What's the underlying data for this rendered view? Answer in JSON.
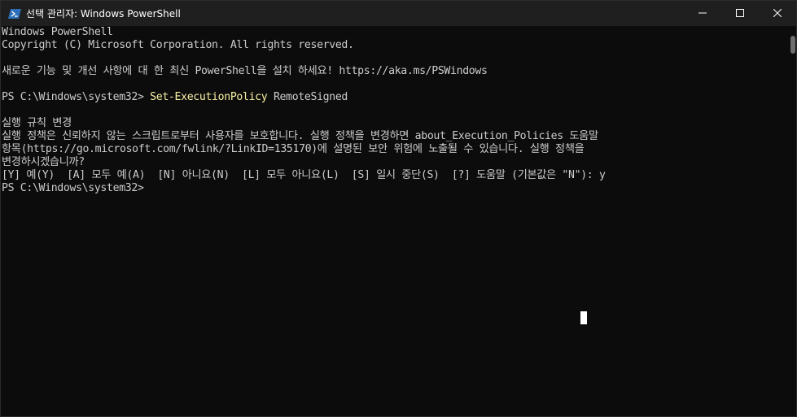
{
  "window": {
    "title": "선택 관리자: Windows PowerShell",
    "icon": "powershell-icon",
    "controls": [
      "minimize-icon",
      "maximize-icon",
      "close-icon"
    ]
  },
  "console": {
    "lines": [
      "Windows PowerShell",
      "Copyright (C) Microsoft Corporation. All rights reserved.",
      "",
      "새로운 기능 및 개선 사항에 대 한 최신 PowerShell을 설치 하세요! https://aka.ms/PSWindows",
      "",
      "",
      "",
      "실행 규칙 변경",
      "실행 정책은 신뢰하지 않는 스크립트로부터 사용자를 보호합니다. 실행 정책을 변경하면 about_Execution_Policies 도움말",
      "항목(https://go.microsoft.com/fwlink/?LinkID=135170)에 설명된 보안 위험에 노출될 수 있습니다. 실행 정책을",
      "변경하시겠습니까?",
      "[Y] 예(Y)  [A] 모두 예(A)  [N] 아니요(N)  [L] 모두 아니요(L)  [S] 일시 중단(S)  [?] 도움말 (기본값은 \"N\"): y",
      "PS C:\\Windows\\system32>"
    ],
    "command_line": {
      "prompt": "PS C:\\Windows\\system32> ",
      "command": "Set-ExecutionPolicy",
      "argument": " RemoteSigned"
    }
  },
  "colors": {
    "background": "#0c0c0c",
    "titlebar": "#1f1f1f",
    "text": "#cccccc",
    "command": "#f9f1a5"
  }
}
